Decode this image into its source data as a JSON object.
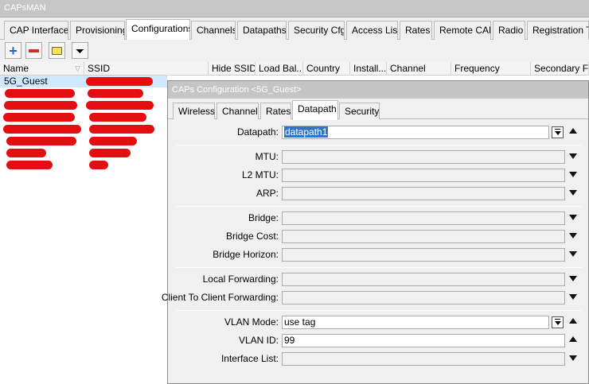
{
  "window": {
    "title": "CAPsMAN"
  },
  "tabs": [
    {
      "label": "CAP Interface",
      "active": false
    },
    {
      "label": "Provisioning",
      "active": false
    },
    {
      "label": "Configurations",
      "active": true
    },
    {
      "label": "Channels",
      "active": false
    },
    {
      "label": "Datapaths",
      "active": false
    },
    {
      "label": "Security Cfg.",
      "active": false
    },
    {
      "label": "Access List",
      "active": false
    },
    {
      "label": "Rates",
      "active": false
    },
    {
      "label": "Remote CAP",
      "active": false
    },
    {
      "label": "Radio",
      "active": false
    },
    {
      "label": "Registration Ta",
      "active": false
    }
  ],
  "toolbar": {
    "add_icon": "plus-icon",
    "remove_icon": "minus-icon",
    "comment_icon": "note-icon",
    "filter_icon": "funnel-icon"
  },
  "table": {
    "columns": [
      "Name",
      "SSID",
      "Hide SSID",
      "Load Bal...",
      "Country",
      "Install...",
      "Channel",
      "Frequency",
      "Secondary Fre"
    ],
    "rows": [
      {
        "name": "5G_Guest",
        "ssid": "",
        "selected": true
      },
      {
        "name": "",
        "ssid": "",
        "selected": false
      },
      {
        "name": "",
        "ssid": "",
        "selected": false
      },
      {
        "name": "",
        "ssid": "",
        "selected": false
      },
      {
        "name": "",
        "ssid": "",
        "selected": false
      },
      {
        "name": "",
        "ssid": "",
        "selected": false
      },
      {
        "name": "",
        "ssid": "",
        "selected": false
      },
      {
        "name": "",
        "ssid": "",
        "selected": false
      }
    ],
    "redaction_color": "#e40d10"
  },
  "dialog": {
    "title": "CAPs Configuration <5G_Guest>",
    "tabs": [
      {
        "label": "Wireless",
        "active": false
      },
      {
        "label": "Channel",
        "active": false
      },
      {
        "label": "Rates",
        "active": false
      },
      {
        "label": "Datapath",
        "active": true
      },
      {
        "label": "Security",
        "active": false
      }
    ],
    "fields": {
      "datapath": {
        "label": "Datapath:",
        "value": "datapath1"
      },
      "mtu": {
        "label": "MTU:",
        "value": ""
      },
      "l2mtu": {
        "label": "L2 MTU:",
        "value": ""
      },
      "arp": {
        "label": "ARP:",
        "value": ""
      },
      "bridge": {
        "label": "Bridge:",
        "value": ""
      },
      "bridge_cost": {
        "label": "Bridge Cost:",
        "value": ""
      },
      "bridge_horizon": {
        "label": "Bridge Horizon:",
        "value": ""
      },
      "local_forwarding": {
        "label": "Local Forwarding:",
        "value": ""
      },
      "c2c_forwarding": {
        "label": "Client To Client Forwarding:",
        "value": ""
      },
      "vlan_mode": {
        "label": "VLAN Mode:",
        "value": "use tag"
      },
      "vlan_id": {
        "label": "VLAN ID:",
        "value": "99"
      },
      "interface_list": {
        "label": "Interface List:",
        "value": ""
      }
    },
    "selection_color": "#3373c4"
  }
}
